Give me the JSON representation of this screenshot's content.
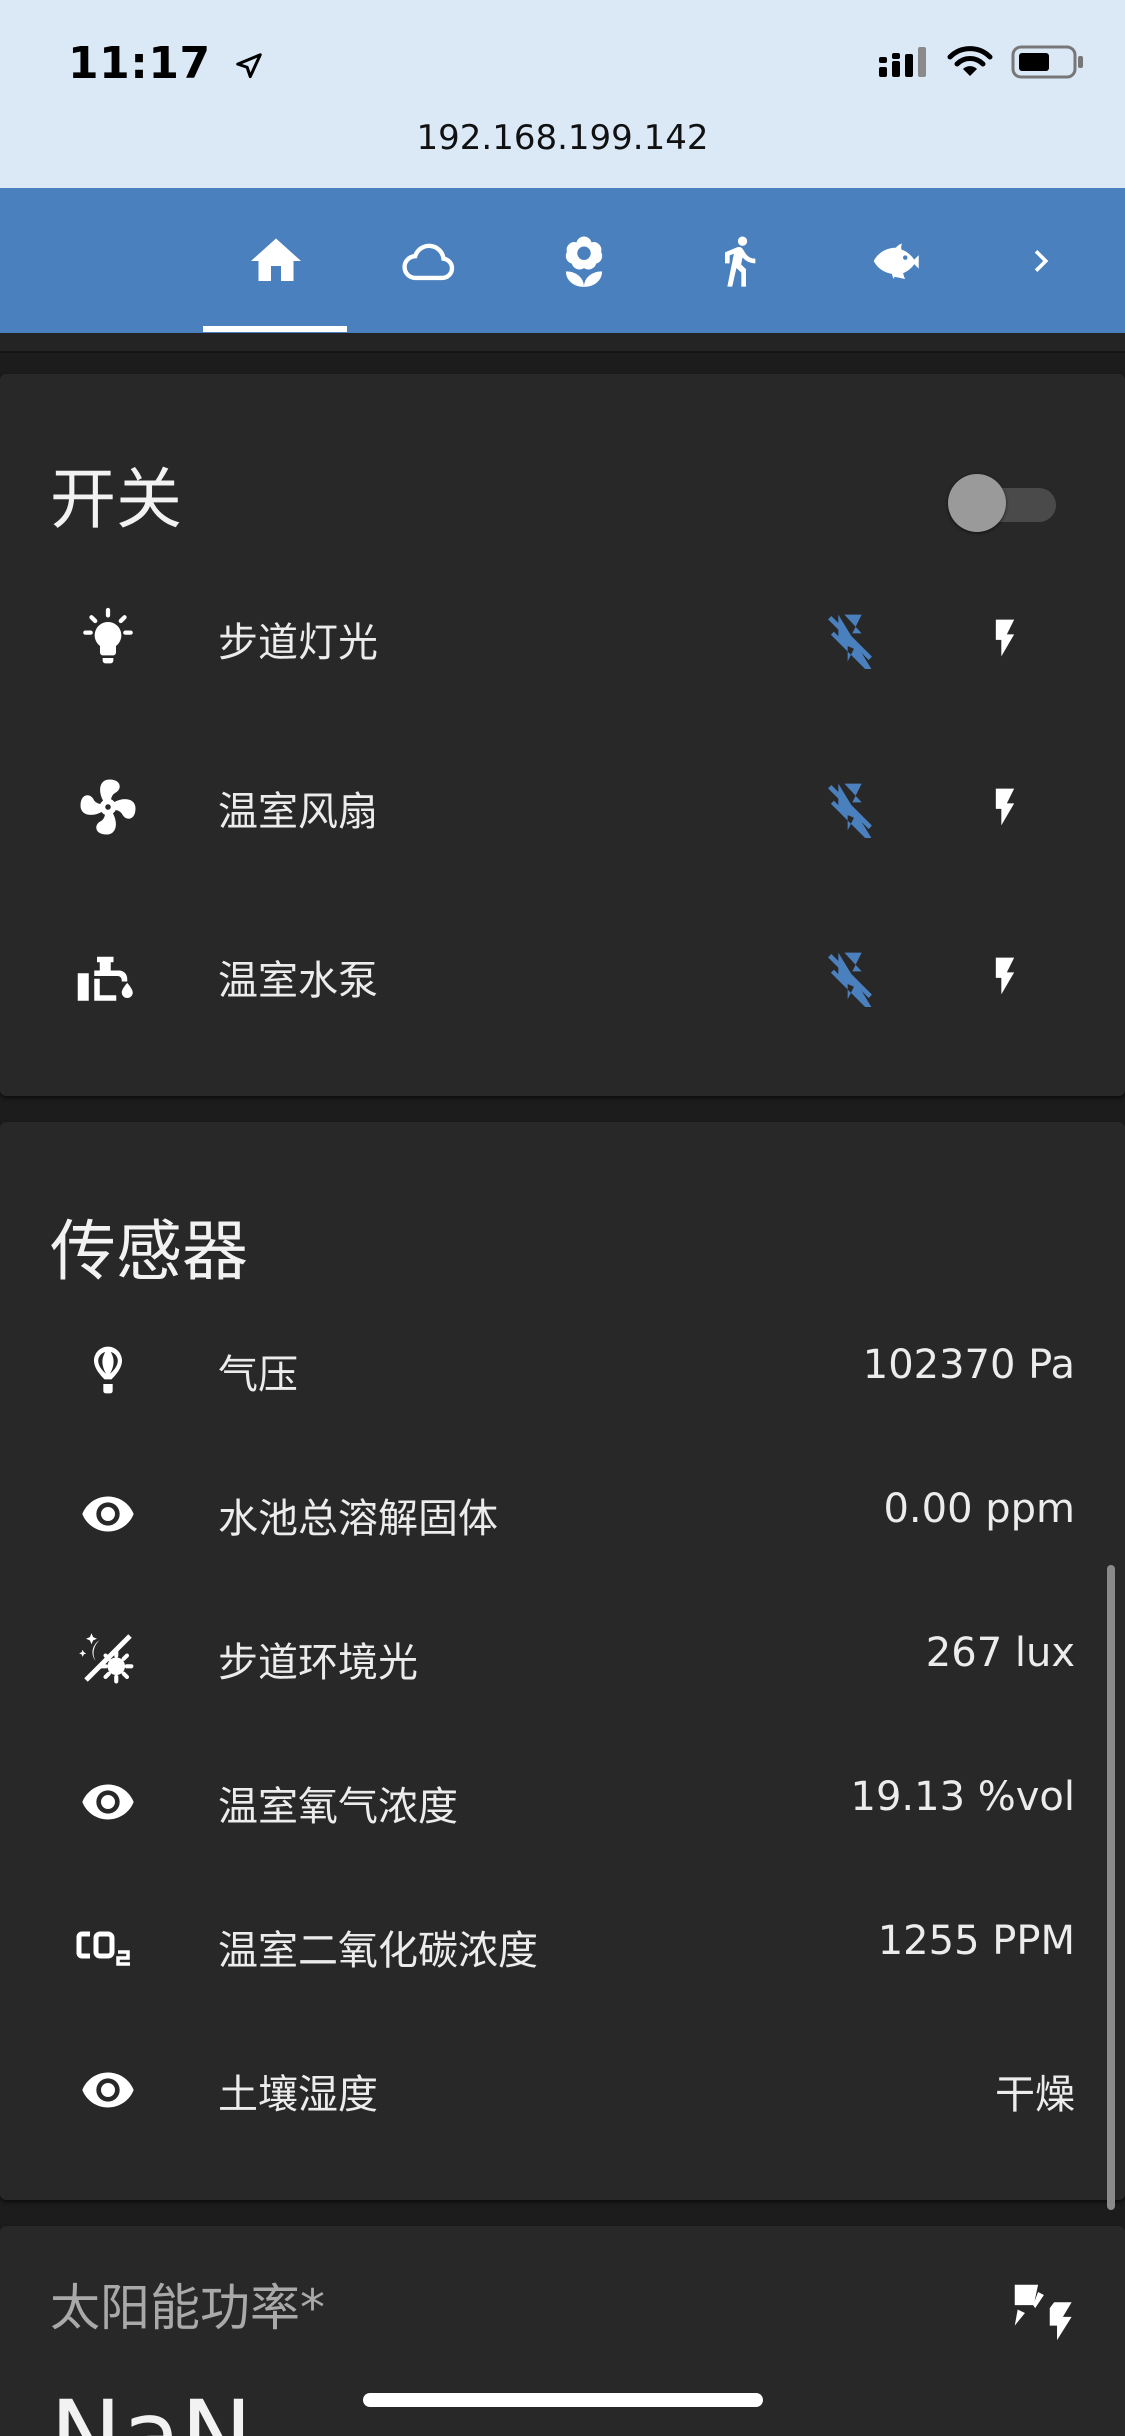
{
  "status_bar": {
    "time": "11:17",
    "url": "192.168.199.142"
  },
  "tabs": [
    {
      "icon": "home-icon",
      "selected": true
    },
    {
      "icon": "cloud-icon",
      "selected": false
    },
    {
      "icon": "flower-icon",
      "selected": false
    },
    {
      "icon": "walk-icon",
      "selected": false
    },
    {
      "icon": "fish-icon",
      "selected": false
    },
    {
      "icon": "chevron-right-icon",
      "selected": false
    }
  ],
  "switches_card": {
    "title": "开关",
    "master_toggle_on": false,
    "items": [
      {
        "icon": "lightbulb-icon",
        "label": "步道灯光"
      },
      {
        "icon": "fan-icon",
        "label": "温室风扇"
      },
      {
        "icon": "water-pump-icon",
        "label": "温室水泵"
      }
    ]
  },
  "sensors_card": {
    "title": "传感器",
    "items": [
      {
        "icon": "hot-air-balloon-icon",
        "label": "气压",
        "value": "102370 Pa"
      },
      {
        "icon": "eye-icon",
        "label": "水池总溶解固体",
        "value": "0.00 ppm"
      },
      {
        "icon": "theme-light-dark-icon",
        "label": "步道环境光",
        "value": "267 lux"
      },
      {
        "icon": "eye-icon",
        "label": "温室氧气浓度",
        "value": "19.13 %vol"
      },
      {
        "icon": "co2-icon",
        "label": "温室二氧化碳浓度",
        "value": "1255 PPM"
      },
      {
        "icon": "eye-icon",
        "label": "土壤湿度",
        "value": "干燥"
      }
    ]
  },
  "solar_card": {
    "title": "太阳能功率*",
    "value": "NaN",
    "icon": "solar-power-icon"
  },
  "colors": {
    "accent": "#4a80bd",
    "card": "#282828",
    "background": "#1c1c1c"
  }
}
